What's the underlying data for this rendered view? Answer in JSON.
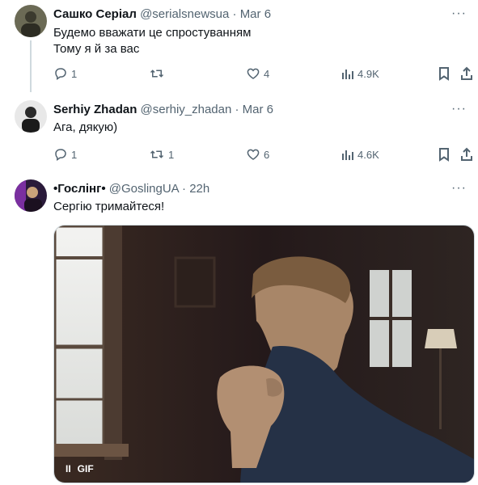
{
  "tweets": [
    {
      "name": "Сашко Серіал",
      "handle": "@serialsnewsua",
      "dot": "·",
      "time": "Mar 6",
      "lines": [
        "Будемо вважати це спростуванням",
        "Тому я й за вас"
      ],
      "replies": "1",
      "retweets": "",
      "likes": "4",
      "views": "4.9K"
    },
    {
      "name": "Serhiy Zhadan",
      "handle": "@serhiy_zhadan",
      "dot": "·",
      "time": "Mar 6",
      "lines": [
        "Ага, дякую)"
      ],
      "replies": "1",
      "retweets": "1",
      "likes": "6",
      "views": "4.6K"
    },
    {
      "name": "•Гослінг•",
      "handle": "@GoslingUA",
      "dot": "·",
      "time": "22h",
      "lines": [
        "Сергію тримайтеся!"
      ]
    }
  ],
  "more_label": "···",
  "media": {
    "badge": "GIF",
    "pause_symbol": "II"
  },
  "icons": [
    "reply-icon",
    "retweet-icon",
    "like-icon",
    "views-icon",
    "bookmark-icon",
    "share-icon",
    "more-icon",
    "pause-icon"
  ],
  "colors": {
    "text": "#0f1419",
    "secondary": "#536471",
    "thread_line": "#cfd9de"
  }
}
